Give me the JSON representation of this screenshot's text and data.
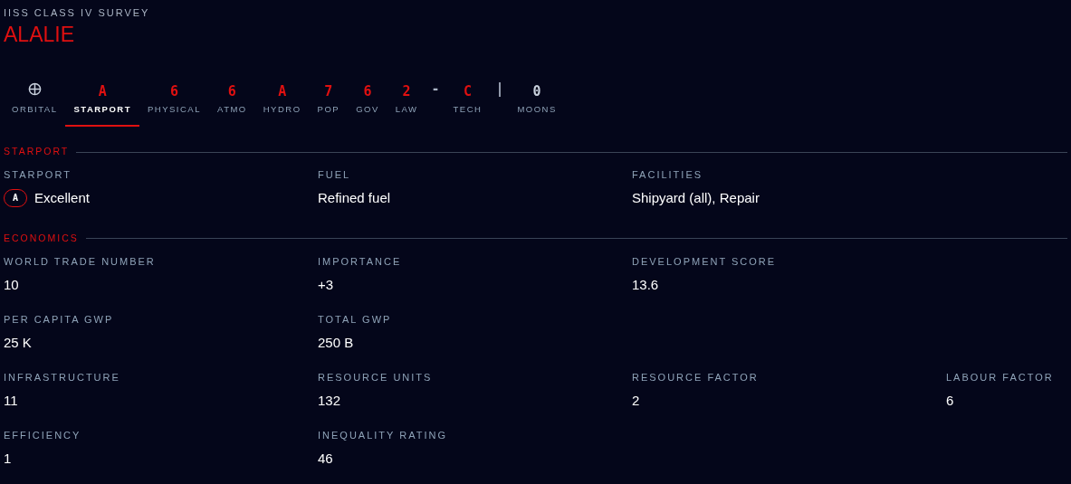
{
  "header": {
    "subtitle": "IISS CLASS IV SURVEY",
    "title": "ALALIE"
  },
  "tabs": [
    {
      "kind": "icon",
      "label": "ORBITAL",
      "selected": false
    },
    {
      "kind": "code",
      "value": "A",
      "label": "STARPORT",
      "selected": true
    },
    {
      "kind": "code",
      "value": "6",
      "label": "PHYSICAL",
      "selected": false
    },
    {
      "kind": "code",
      "value": "6",
      "label": "ATMO",
      "selected": false
    },
    {
      "kind": "code",
      "value": "A",
      "label": "HYDRO",
      "selected": false
    },
    {
      "kind": "code",
      "value": "7",
      "label": "POP",
      "selected": false
    },
    {
      "kind": "code",
      "value": "6",
      "label": "GOV",
      "selected": false
    },
    {
      "kind": "code",
      "value": "2",
      "label": "LAW",
      "selected": false
    },
    {
      "kind": "separator",
      "value": "-"
    },
    {
      "kind": "code",
      "value": "C",
      "label": "TECH",
      "selected": false
    },
    {
      "kind": "separator",
      "value": "|"
    },
    {
      "kind": "count",
      "value": "0",
      "label": "MOONS",
      "selected": false
    }
  ],
  "sections": [
    {
      "title": "STARPORT",
      "rows": [
        [
          {
            "label": "STARPORT",
            "badge": "A",
            "value": "Excellent"
          },
          {
            "label": "FUEL",
            "value": "Refined fuel"
          },
          {
            "label": "FACILITIES",
            "value": "Shipyard (all), Repair"
          }
        ]
      ]
    },
    {
      "title": "ECONOMICS",
      "rows": [
        [
          {
            "label": "WORLD TRADE NUMBER",
            "value": "10"
          },
          {
            "label": "IMPORTANCE",
            "value": "+3"
          },
          {
            "label": "DEVELOPMENT SCORE",
            "value": "13.6"
          }
        ],
        [
          {
            "label": "PER CAPITA GWP",
            "value": "25 K"
          },
          {
            "label": "TOTAL GWP",
            "value": "250 B"
          }
        ],
        [
          {
            "label": "INFRASTRUCTURE",
            "value": "11"
          },
          {
            "label": "RESOURCE UNITS",
            "value": "132"
          },
          {
            "label": "RESOURCE FACTOR",
            "value": "2"
          },
          {
            "label": "LABOUR FACTOR",
            "value": "6"
          }
        ],
        [
          {
            "label": "EFFICIENCY",
            "value": "1"
          },
          {
            "label": "INEQUALITY RATING",
            "value": "46"
          }
        ]
      ]
    }
  ]
}
